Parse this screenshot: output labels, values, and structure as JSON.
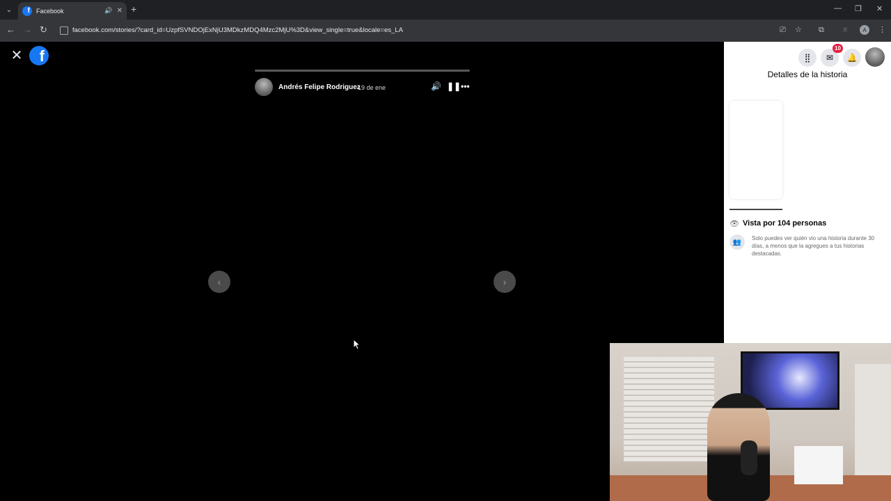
{
  "browser": {
    "tab_title": "Facebook",
    "url": "facebook.com/stories/?card_id=UzpfSVNDOjExNjU3MDkzMDQ4Mzc2MjU%3D&view_single=true&locale=es_LA",
    "profile_initial": "A"
  },
  "story": {
    "author": "Andrés Felipe Rodriguez",
    "date": "19 de ene",
    "progress": 0.0
  },
  "panel": {
    "notifications_badge": "10",
    "title": "Detalles de la historia",
    "views_label": "Vista por 104 personas",
    "views_note": "Solo puedes ver quién vio una historia durante 30 días, a menos que la agregues a tus historias destacadas."
  },
  "colors": {
    "fb_blue": "#1877f2",
    "badge_red": "#e41e3f"
  }
}
